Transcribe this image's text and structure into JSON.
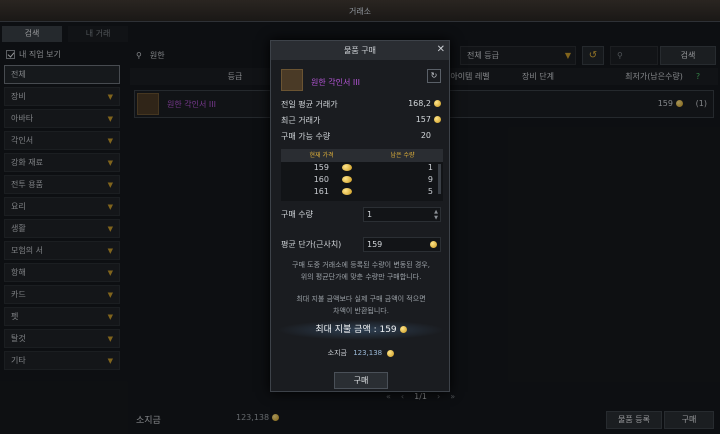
{
  "window": {
    "title": "거래소"
  },
  "tabs": [
    {
      "label": "검색"
    },
    {
      "label": "내 거래"
    }
  ],
  "sidebar": {
    "job_filter_label": "내 직업 보기",
    "categories": [
      {
        "label": "전체"
      },
      {
        "label": "장비"
      },
      {
        "label": "아바타"
      },
      {
        "label": "각인서"
      },
      {
        "label": "강화 재료"
      },
      {
        "label": "전투 용품"
      },
      {
        "label": "요리"
      },
      {
        "label": "생활"
      },
      {
        "label": "모험의 서"
      },
      {
        "label": "항해"
      },
      {
        "label": "카드"
      },
      {
        "label": "펫"
      },
      {
        "label": "탈것"
      },
      {
        "label": "기타"
      }
    ]
  },
  "search": {
    "query": "원한",
    "grade_label": "전체 등급",
    "search_button": "검색"
  },
  "table": {
    "headers": {
      "grade": "등급",
      "item_level": "아이템 레벨",
      "equip_stage": "장비 단계",
      "lowest_price": "최저가(남은수량)",
      "help": "?"
    },
    "rows": [
      {
        "name": "원한 각인서 III",
        "price": "159",
        "count": "(1)"
      }
    ]
  },
  "footer": {
    "gold_label": "소지금",
    "gold_value": "123,138",
    "page": "1/1",
    "register_button": "물품 등록",
    "buy_button": "구매"
  },
  "modal": {
    "title": "물품 구매",
    "item_name": "원한 각인서 III",
    "prev_avg_label": "전일 평균 거래가",
    "prev_avg_value": "168,2",
    "recent_label": "최근 거래가",
    "recent_value": "157",
    "available_label": "구매 가능 수량",
    "available_value": "20",
    "grid_headers": {
      "price": "현재 가격",
      "remaining": "남은 수량"
    },
    "grid_rows": [
      {
        "price": "159",
        "remaining": "1"
      },
      {
        "price": "160",
        "remaining": "9"
      },
      {
        "price": "161",
        "remaining": "5"
      }
    ],
    "qty_label": "구매 수량",
    "qty_value": "1",
    "avg_label": "평균 단가(근사치)",
    "avg_value": "159",
    "notice1": "구매 도중 거래소에 등록된 수량이 변동된 경우,",
    "notice2": "위의 평균단가에 맞춘 수량만 구매합니다.",
    "notice3": "최대 지불 금액보다 실제 구매 금액이 적으면",
    "notice4": "차액이 반환됩니다.",
    "max_pay": "최대 지불 금액 : 159",
    "hold_label": "소지금",
    "hold_value": "123,138",
    "buy_button": "구매"
  }
}
